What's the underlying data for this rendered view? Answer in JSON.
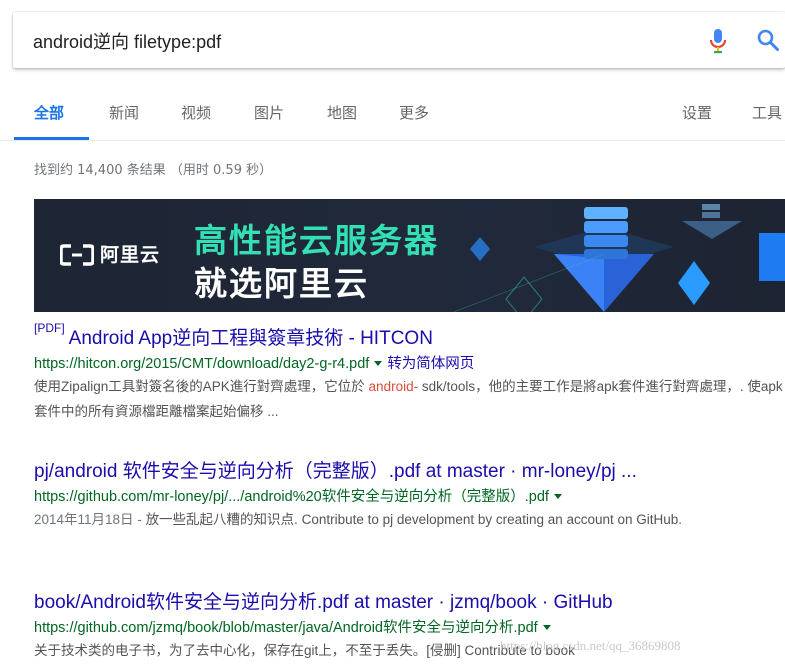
{
  "search": {
    "query": "android逆向 filetype:pdf"
  },
  "tabs": [
    {
      "label": "全部"
    },
    {
      "label": "新闻"
    },
    {
      "label": "视频"
    },
    {
      "label": "图片"
    },
    {
      "label": "地图"
    },
    {
      "label": "更多"
    },
    {
      "label": "设置"
    },
    {
      "label": "工具"
    }
  ],
  "stats": "找到约 14,400 条结果 （用时 0.59 秒）",
  "ad": {
    "brand": "阿里云",
    "headline1": "高性能云服务器",
    "headline2": "就选阿里云"
  },
  "results": [
    {
      "tag": "[PDF]",
      "title": "Android App逆向工程與簽章技術 - HITCON",
      "url": "https://hitcon.org/2015/CMT/download/day2-g-r4.pdf",
      "translate": "转为简体网页",
      "snippet_a": "使用Zipalign工具對簽名後的APK進行對齊處理，它位於 ",
      "snippet_hl": "android-",
      "snippet_b": " sdk/tools，他的主要工作是將apk套件進行對齊處理，. 使apk套件中的所有資源檔距離檔案起始偏移 ..."
    },
    {
      "title": "pj/android 软件安全与逆向分析（完整版）.pdf at master · mr-loney/pj ...",
      "url": "https://github.com/mr-loney/pj/.../android%20软件安全与逆向分析（完整版）.pdf",
      "date": "2014年11月18日 - ",
      "snippet": "放一些乱起八糟的知识点. Contribute to pj development by creating an account on GitHub."
    },
    {
      "title": "book/Android软件安全与逆向分析.pdf at master · jzmq/book · GitHub",
      "url": "https://github.com/jzmq/book/blob/master/java/Android软件安全与逆向分析.pdf",
      "snippet": "关于技术类的电子书，为了去中心化，保存在git上，不至于丢失。[侵删] Contribute to book"
    }
  ],
  "watermark": "https://blog.csdn.net/qq_36869808",
  "colors": {
    "link": "#1a0dab",
    "url": "#006621",
    "accent": "#1a73e8",
    "highlight": "#dd4b39",
    "banner_bg": "#1e2534",
    "banner_green": "#32e0b4"
  }
}
